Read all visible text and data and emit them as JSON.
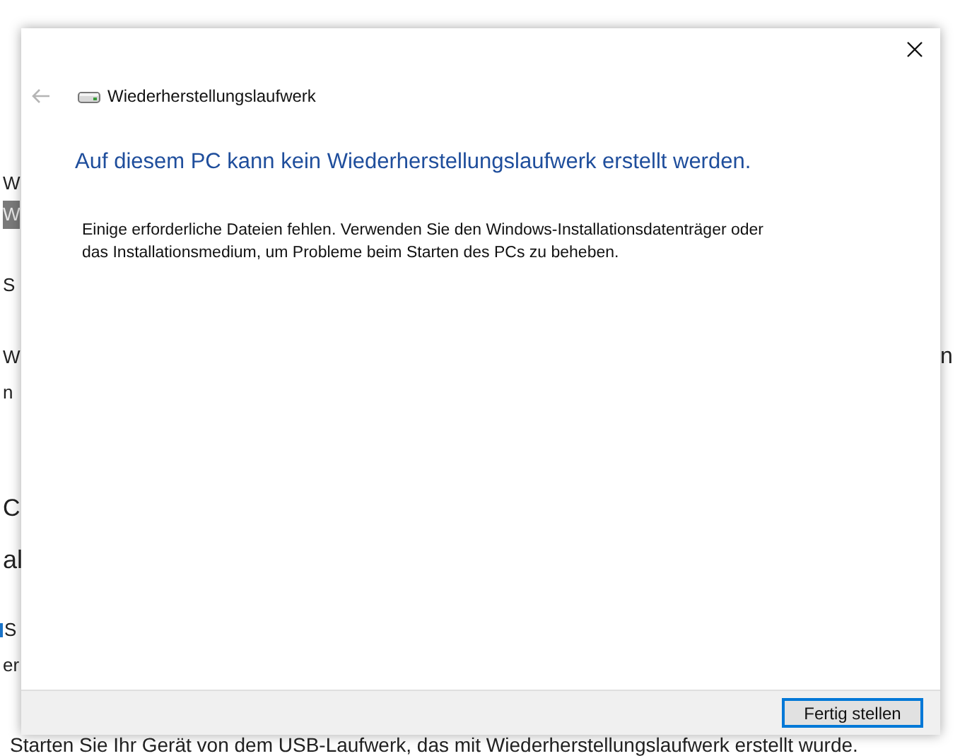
{
  "background_page": {
    "left_fragments": [
      {
        "text": "W",
        "kind": "text"
      },
      {
        "text": "W",
        "kind": "selected"
      },
      {
        "text": "S",
        "kind": "text"
      },
      {
        "text": "W",
        "kind": "text"
      },
      {
        "text": "n",
        "kind": "text"
      },
      {
        "text": "C",
        "kind": "subheading"
      },
      {
        "text": "al",
        "kind": "heading"
      },
      {
        "text": "S",
        "kind": "link"
      },
      {
        "text": "er",
        "kind": "text"
      }
    ],
    "right_fragment": "n",
    "bottom_line": "Starten Sie Ihr Gerät von dem USB-Laufwerk, das mit Wiederherstellungslaufwerk erstellt wurde."
  },
  "dialog": {
    "title": "Wiederherstellungslaufwerk",
    "heading": "Auf diesem PC kann kein Wiederherstellungslaufwerk erstellt werden.",
    "message": "Einige erforderliche Dateien fehlen. Verwenden Sie den Windows-Installationsdatenträger oder das Installationsmedium, um Probleme beim Starten des PCs zu beheben.",
    "buttons": [
      {
        "label": "Fertig stellen",
        "selected": true
      }
    ]
  }
}
